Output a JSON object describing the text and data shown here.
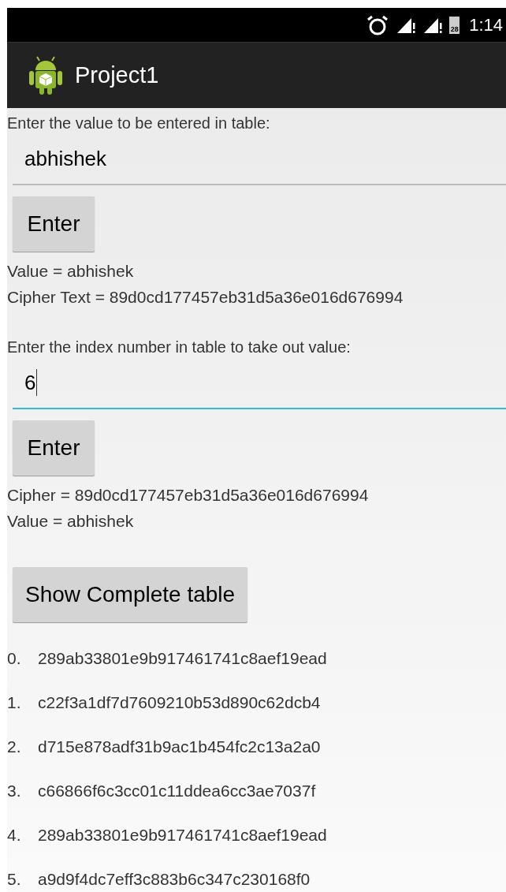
{
  "status_bar": {
    "time": "1:14",
    "battery": "28"
  },
  "app_bar": {
    "title": "Project1"
  },
  "sections": [
    {
      "kind": "form",
      "label": "Enter the value to be entered in table:",
      "field": {
        "value": "abhishek",
        "focused": false
      },
      "button": "Enter",
      "results": [
        "Value = abhishek",
        "Cipher Text = 89d0cd177457eb31d5a36e016d676994"
      ]
    },
    {
      "kind": "form",
      "label": "Enter the index number in table to take out value:",
      "field": {
        "value": "6",
        "focused": true
      },
      "button": "Enter",
      "results": [
        "Cipher = 89d0cd177457eb31d5a36e016d676994",
        "Value = abhishek"
      ]
    }
  ],
  "table_button": "Show Complete table",
  "table_rows": [
    {
      "index": "0.",
      "value": "289ab33801e9b917461741c8aef19ead"
    },
    {
      "index": "1.",
      "value": "c22f3a1df7d7609210b53d890c62dcb4"
    },
    {
      "index": "2.",
      "value": "d715e878adf31b9ac1b454fc2c13a2a0"
    },
    {
      "index": "3.",
      "value": "c66866f6c3cc01c11ddea6cc3ae7037f"
    },
    {
      "index": "4.",
      "value": "289ab33801e9b917461741c8aef19ead"
    },
    {
      "index": "5.",
      "value": "a9d9f4dc7eff3c883b6c347c230168f0"
    }
  ]
}
